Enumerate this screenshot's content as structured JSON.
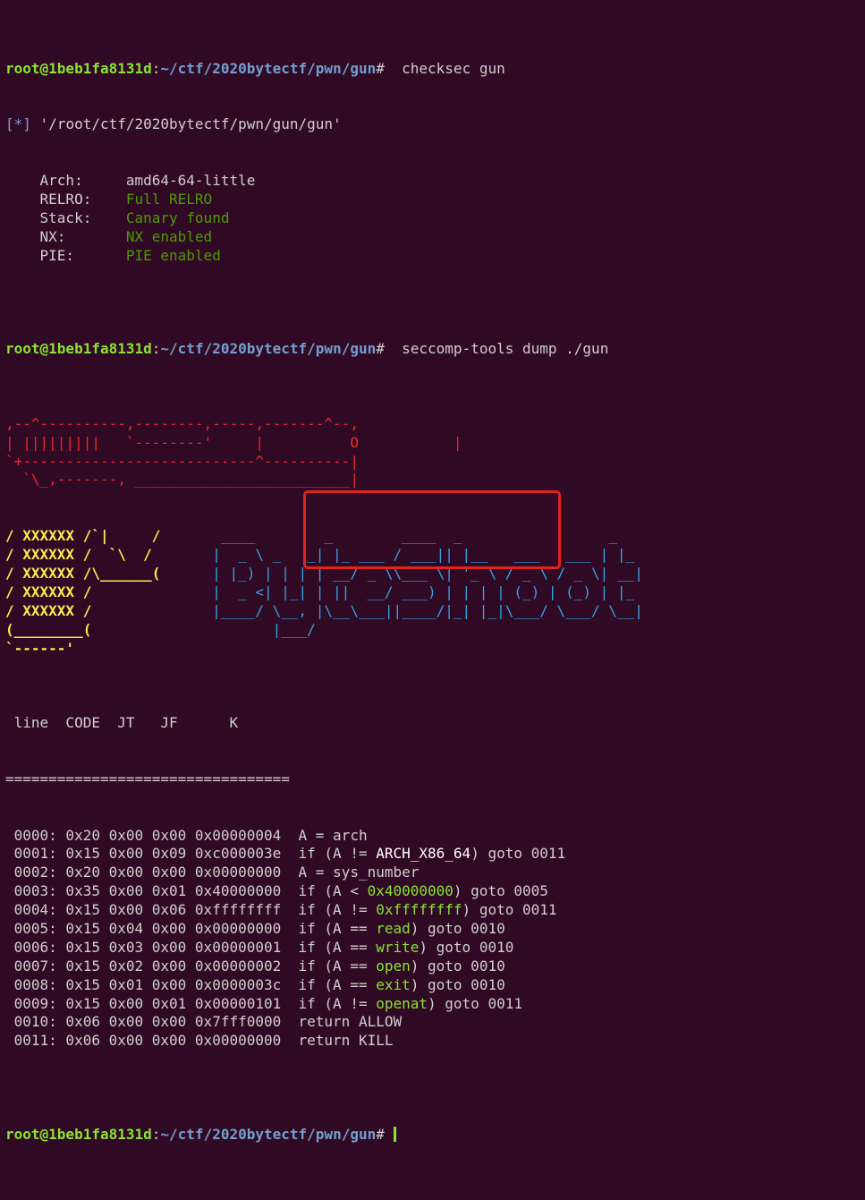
{
  "prompt": {
    "user": "root@1beb1fa8131d",
    "path": "~/ctf/2020bytectf/pwn/gun"
  },
  "checksec": {
    "command": " checksec gun",
    "file_line": "[*] '/root/ctf/2020bytectf/pwn/gun/gun'",
    "fields": [
      {
        "key": "    Arch:     ",
        "value": "amd64-64-little",
        "style": ""
      },
      {
        "key": "    RELRO:    ",
        "value": "Full RELRO",
        "style": "green"
      },
      {
        "key": "    Stack:    ",
        "value": "Canary found",
        "style": "green"
      },
      {
        "key": "    NX:       ",
        "value": "NX enabled",
        "style": "green"
      },
      {
        "key": "    PIE:      ",
        "value": "PIE enabled",
        "style": "green"
      }
    ]
  },
  "seccomp": {
    "command": " seccomp-tools dump ./gun",
    "art_red": [
      ",--^----------,--------,-----,-------^--,",
      "| |||||||||   `--------'     |          O",
      "`+---------------------------^----------|",
      "  `\\_,-------, _________________________|"
    ],
    "art_red_trailing": [
      "",
      "           |",
      "",
      ""
    ],
    "art_left": [
      "/ XXXXXX /`|     /",
      "/ XXXXXX /  `\\  /",
      "/ XXXXXX /\\______(",
      "/ XXXXXX /",
      "/ XXXXXX /",
      "(________(",
      "`------'"
    ],
    "art_right": [
      "       ____        _        ____  _                 _   ",
      "      |  _ \\ _   _| |_ ___ / ___|| |__   ___   ___ | |_ ",
      "      | |_) | | | | __/ _ \\\\___ \\| '_ \\ / _ \\ / _ \\| __|",
      "      |  _ <| |_| | ||  __/ ___) | | | | (_) | (_) | |_ ",
      "      |____/ \\__, |\\__\\___||____/|_| |_|\\___/ \\___/ \\__|",
      "             |___/",
      ""
    ],
    "header": " line  CODE  JT   JF      K",
    "separator": "=================================",
    "rows": [
      {
        "prefix": " 0000: 0x20 0x00 0x00 0x00000004  ",
        "parts": [
          {
            "t": "A = arch",
            "c": ""
          }
        ]
      },
      {
        "prefix": " 0001: 0x15 0x00 0x09 0xc000003e  ",
        "parts": [
          {
            "t": "if (A != ",
            "c": ""
          },
          {
            "t": "ARCH_X86_64",
            "c": "white"
          },
          {
            "t": ") goto 0011",
            "c": ""
          }
        ]
      },
      {
        "prefix": " 0002: 0x20 0x00 0x00 0x00000000  ",
        "parts": [
          {
            "t": "A = sys_number",
            "c": ""
          }
        ]
      },
      {
        "prefix": " 0003: 0x35 0x00 0x01 0x40000000  ",
        "parts": [
          {
            "t": "if (A < ",
            "c": ""
          },
          {
            "t": "0x40000000",
            "c": "bgreen"
          },
          {
            "t": ") goto 0005",
            "c": ""
          }
        ]
      },
      {
        "prefix": " 0004: 0x15 0x00 0x06 0xffffffff  ",
        "parts": [
          {
            "t": "if (A != ",
            "c": ""
          },
          {
            "t": "0xffffffff",
            "c": "bgreen"
          },
          {
            "t": ") goto 0011",
            "c": ""
          }
        ]
      },
      {
        "prefix": " 0005: 0x15 0x04 0x00 0x00000000  ",
        "parts": [
          {
            "t": "if (A == ",
            "c": ""
          },
          {
            "t": "read",
            "c": "bgreen"
          },
          {
            "t": ") goto 0010",
            "c": ""
          }
        ]
      },
      {
        "prefix": " 0006: 0x15 0x03 0x00 0x00000001  ",
        "parts": [
          {
            "t": "if (A == ",
            "c": ""
          },
          {
            "t": "write",
            "c": "bgreen"
          },
          {
            "t": ") goto 0010",
            "c": ""
          }
        ]
      },
      {
        "prefix": " 0007: 0x15 0x02 0x00 0x00000002  ",
        "parts": [
          {
            "t": "if (A == ",
            "c": ""
          },
          {
            "t": "open",
            "c": "bgreen"
          },
          {
            "t": ") goto 0010",
            "c": ""
          }
        ]
      },
      {
        "prefix": " 0008: 0x15 0x01 0x00 0x0000003c  ",
        "parts": [
          {
            "t": "if (A == ",
            "c": ""
          },
          {
            "t": "exit",
            "c": "bgreen"
          },
          {
            "t": ") goto 0010",
            "c": ""
          }
        ]
      },
      {
        "prefix": " 0009: 0x15 0x00 0x01 0x00000101  ",
        "parts": [
          {
            "t": "if (A != ",
            "c": ""
          },
          {
            "t": "openat",
            "c": "bgreen"
          },
          {
            "t": ") goto 0011",
            "c": ""
          }
        ]
      },
      {
        "prefix": " 0010: 0x06 0x00 0x00 0x7fff0000  ",
        "parts": [
          {
            "t": "return ALLOW",
            "c": ""
          }
        ]
      },
      {
        "prefix": " 0011: 0x06 0x00 0x00 0x00000000  ",
        "parts": [
          {
            "t": "return KILL",
            "c": ""
          }
        ]
      }
    ]
  },
  "colors": {
    "background": "#300a24",
    "highlight": "#e0231f",
    "prompt_user": "#8ae234",
    "prompt_path": "#729fcf"
  }
}
